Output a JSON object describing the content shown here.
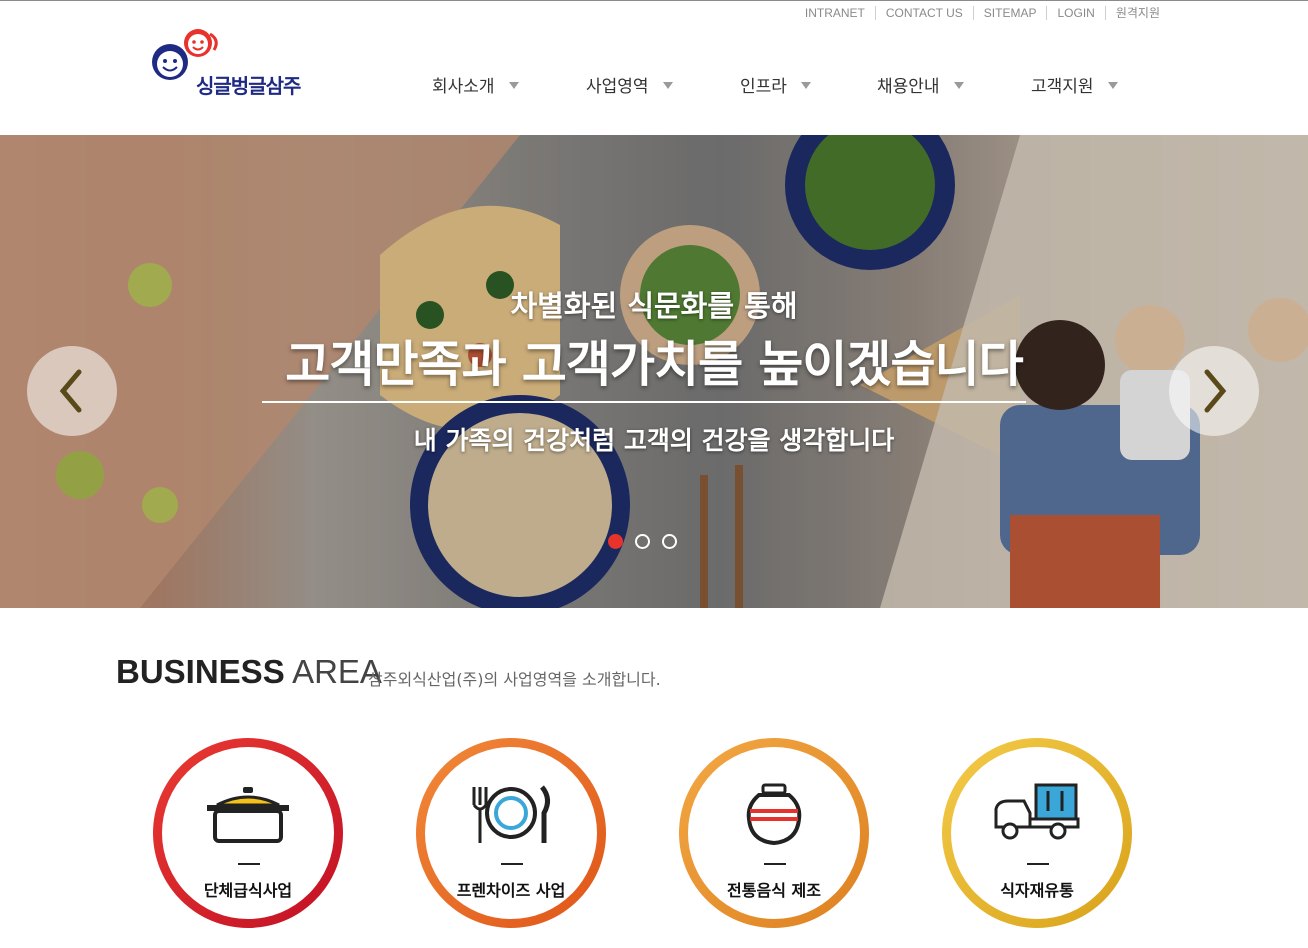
{
  "util_links": [
    "INTRANET",
    "CONTACT US",
    "SITEMAP",
    "LOGIN",
    "원격지원"
  ],
  "logo": {
    "text": "싱글벙글삼주"
  },
  "gnb": [
    "회사소개",
    "사업영역",
    "인프라",
    "채용안내",
    "고객지원"
  ],
  "hero": {
    "subtitle": "차별화된 식문화를 통해",
    "title": "고객만족과 고객가치를 높이겠습니다",
    "description": "내 가족의 건강처럼 고객의 건강을 생각합니다",
    "slide_count": 3,
    "active_slide": 1
  },
  "business": {
    "title_bold": "BUSINESS",
    "title_light": "AREA",
    "description": "삼주외식산업(주)의 사업영역을 소개합니다.",
    "items": [
      {
        "label": "단체급식사업",
        "icon": "pot-icon",
        "color_from": "#e8322c",
        "color_to": "#c8102e"
      },
      {
        "label": "프렌차이즈 사업",
        "icon": "plate-cutlery-icon",
        "color_from": "#f08030",
        "color_to": "#e05a1a"
      },
      {
        "label": "전통음식 제조",
        "icon": "jar-icon",
        "color_from": "#f2a23a",
        "color_to": "#e08420"
      },
      {
        "label": "식자재유통",
        "icon": "truck-icon",
        "color_from": "#f3c844",
        "color_to": "#d9a41c"
      }
    ]
  }
}
